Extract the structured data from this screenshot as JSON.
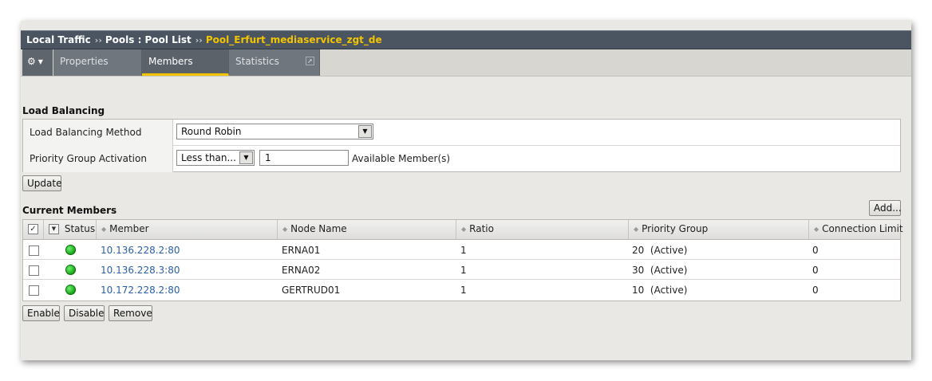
{
  "breadcrumb": {
    "items": [
      "Local Traffic",
      "Pools : Pool List"
    ],
    "separator": "››",
    "current": "Pool_Erfurt_mediaservice_zgt_de"
  },
  "tabs": {
    "gear_icon": "gear-icon",
    "items": [
      {
        "label": "Properties",
        "active": false
      },
      {
        "label": "Members",
        "active": true
      },
      {
        "label": "Statistics",
        "active": false
      }
    ],
    "statistics_icon": "external-link-icon",
    "accent": "#f3c400"
  },
  "load_balancing": {
    "title": "Load Balancing",
    "method_label": "Load Balancing Method",
    "method_value": "Round Robin",
    "priority_label": "Priority Group Activation",
    "priority_value": "Less than...",
    "priority_count": "1",
    "priority_suffix": "Available Member(s)",
    "update_button": "Update"
  },
  "members": {
    "title": "Current Members",
    "add_button": "Add...",
    "columns": {
      "status": "Status",
      "member": "Member",
      "node_name": "Node Name",
      "ratio": "Ratio",
      "priority_group": "Priority Group",
      "connection_limit": "Connection Limit"
    },
    "rows": [
      {
        "member": "10.136.228.2:80",
        "node_name": "ERNA01",
        "ratio": "1",
        "priority_group": "20  (Active)",
        "connection_limit": "0",
        "status_color": "#22b022"
      },
      {
        "member": "10.136.228.3:80",
        "node_name": "ERNA02",
        "ratio": "1",
        "priority_group": "30  (Active)",
        "connection_limit": "0",
        "status_color": "#22b022"
      },
      {
        "member": "10.172.228.2:80",
        "node_name": "GERTRUD01",
        "ratio": "1",
        "priority_group": "10  (Active)",
        "connection_limit": "0",
        "status_color": "#22b022"
      }
    ],
    "actions": [
      "Enable",
      "Disable",
      "Remove"
    ]
  }
}
